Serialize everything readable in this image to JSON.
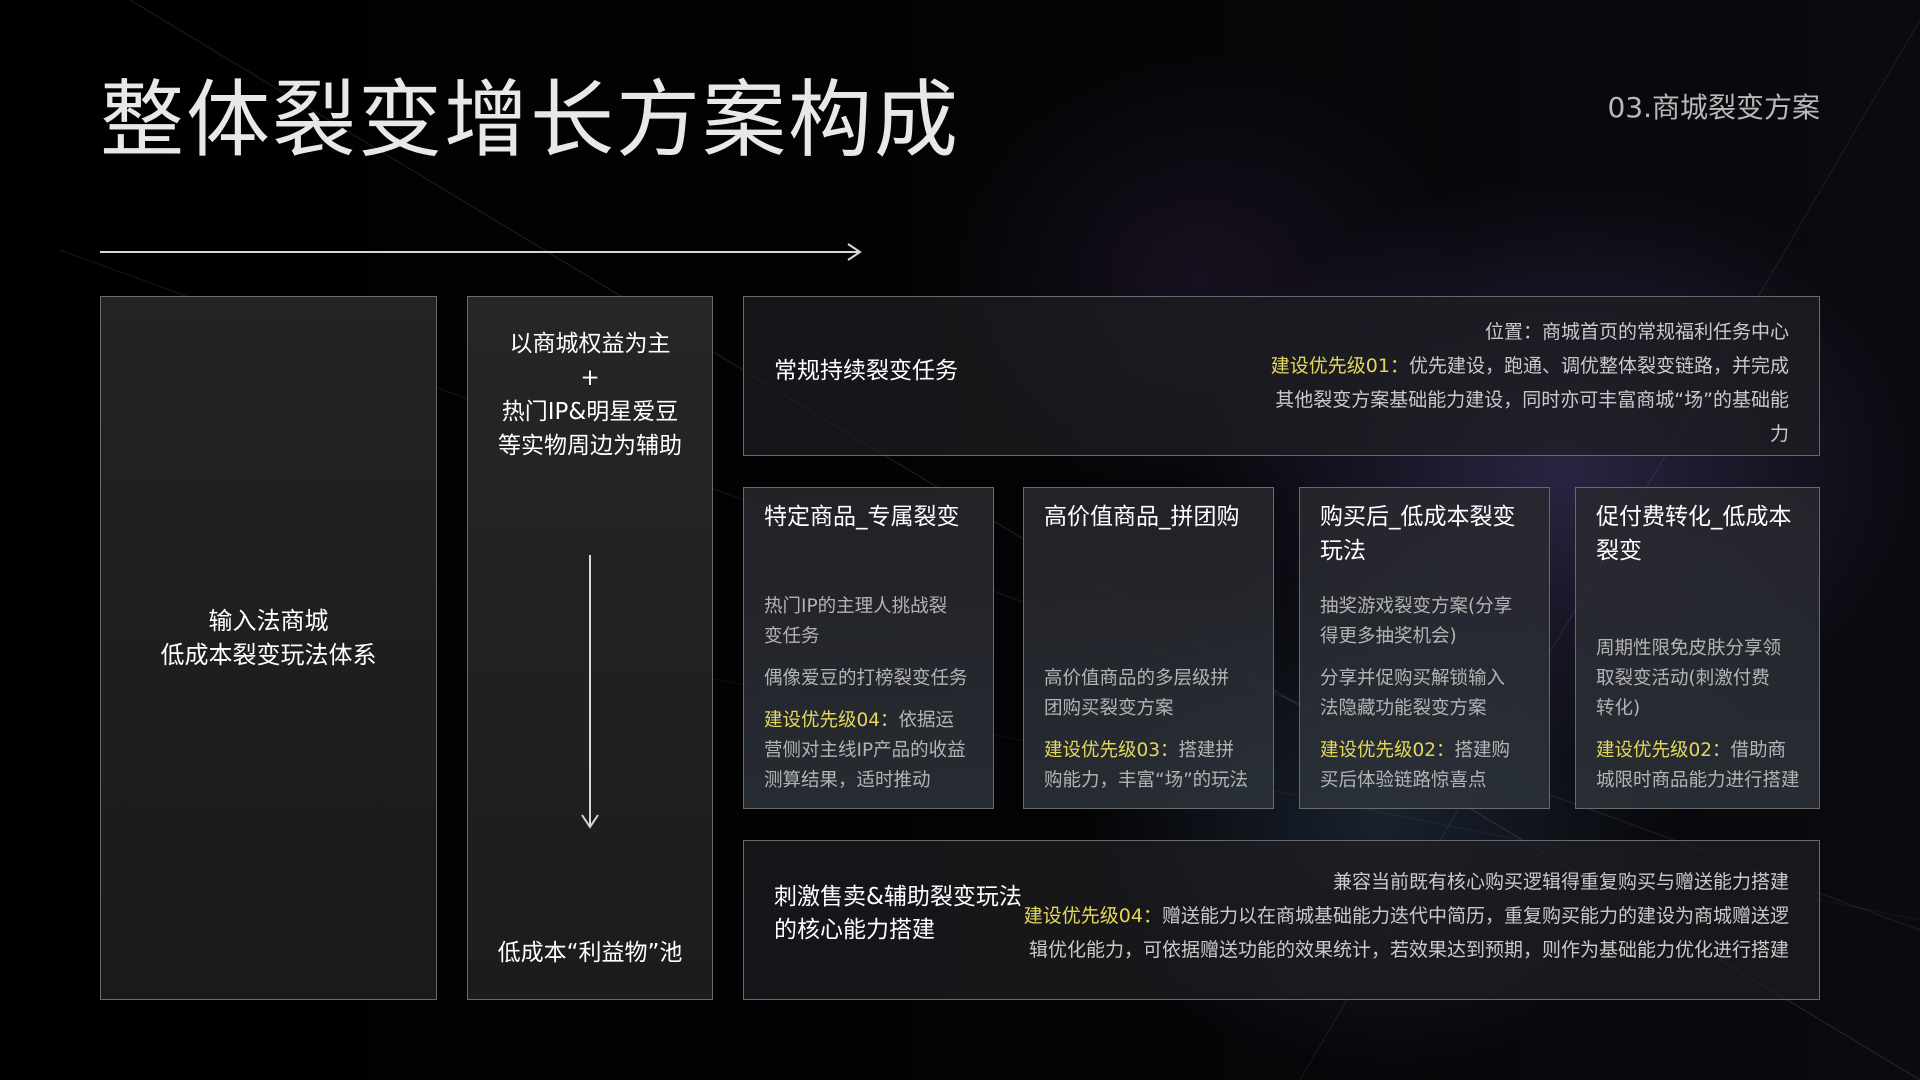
{
  "title": "整体裂变增长方案构成",
  "section": "03.商城裂变方案",
  "column1": {
    "text": "输入法商城\n低成本裂变玩法体系"
  },
  "column2": {
    "top_text": "以商城权益为主\n+\n热门IP&明星爱豆\n等实物周边为辅助",
    "bottom_text": "低成本“利益物”池"
  },
  "top_row": {
    "title": "常规持续裂变任务",
    "line1": "位置：商城首页的常规福利任务中心",
    "priority_label": "建设优先级01：",
    "line2_rest": "优先建设，跑通、调优整体裂变链路，并完成",
    "line3": "其他裂变方案基础能力建设，同时亦可丰富商城“场”的基础能",
    "line4": "力"
  },
  "cards": [
    {
      "title": "特定商品_专属裂变",
      "desc1": [
        "热门IP的主理人挑战裂",
        "变任务"
      ],
      "desc2": [
        "偶像爱豆的打榜裂变任务"
      ],
      "priority_label": "建设优先级04：",
      "priority_first": "依据运",
      "priority_rest": [
        "营侧对主线IP产品的收益",
        "测算结果，适时推动"
      ]
    },
    {
      "title": "高价值商品_拼团购",
      "desc1": [
        "高价值商品的多层级拼",
        "团购买裂变方案"
      ],
      "priority_label": "建设优先级03：",
      "priority_first": "搭建拼",
      "priority_rest": [
        "购能力，丰富“场”的玩法"
      ]
    },
    {
      "title": "购买后_低成本裂变玩法",
      "desc1": [
        "抽奖游戏裂变方案(分享",
        "得更多抽奖机会)"
      ],
      "desc2": [
        "分享并促购买解锁输入",
        "法隐藏功能裂变方案"
      ],
      "priority_label": "建设优先级02：",
      "priority_first": "搭建购",
      "priority_rest": [
        "买后体验链路惊喜点"
      ]
    },
    {
      "title": "促付费转化_低成本裂变",
      "desc1": [
        "周期性限免皮肤分享领",
        "取裂变活动(刺激付费",
        "转化)"
      ],
      "priority_label": "建设优先级02：",
      "priority_first": "借助商",
      "priority_rest": [
        "城限时商品能力进行搭建"
      ]
    }
  ],
  "bottom_row": {
    "title": "刺激售卖&辅助裂变玩法\n的核心能力搭建",
    "line1": "兼容当前既有核心购买逻辑得重复购买与赠送能力搭建",
    "priority_label": "建设优先级04：",
    "line2_rest": "赠送能力以在商城基础能力迭代中简历，重复购买能力的建设为商城赠送逻",
    "line3": "辑优化能力，可依据赠送功能的效果统计，若效果达到预期，则作为基础能力优化进行搭建"
  },
  "colors": {
    "background": "#000000",
    "priority": "#e4d75a",
    "border": "#6a6a6a",
    "body_text": "#b3b3b3"
  },
  "icons": {
    "horizontal_arrow": "arrow-right-icon",
    "vertical_arrow": "arrow-down-icon"
  }
}
